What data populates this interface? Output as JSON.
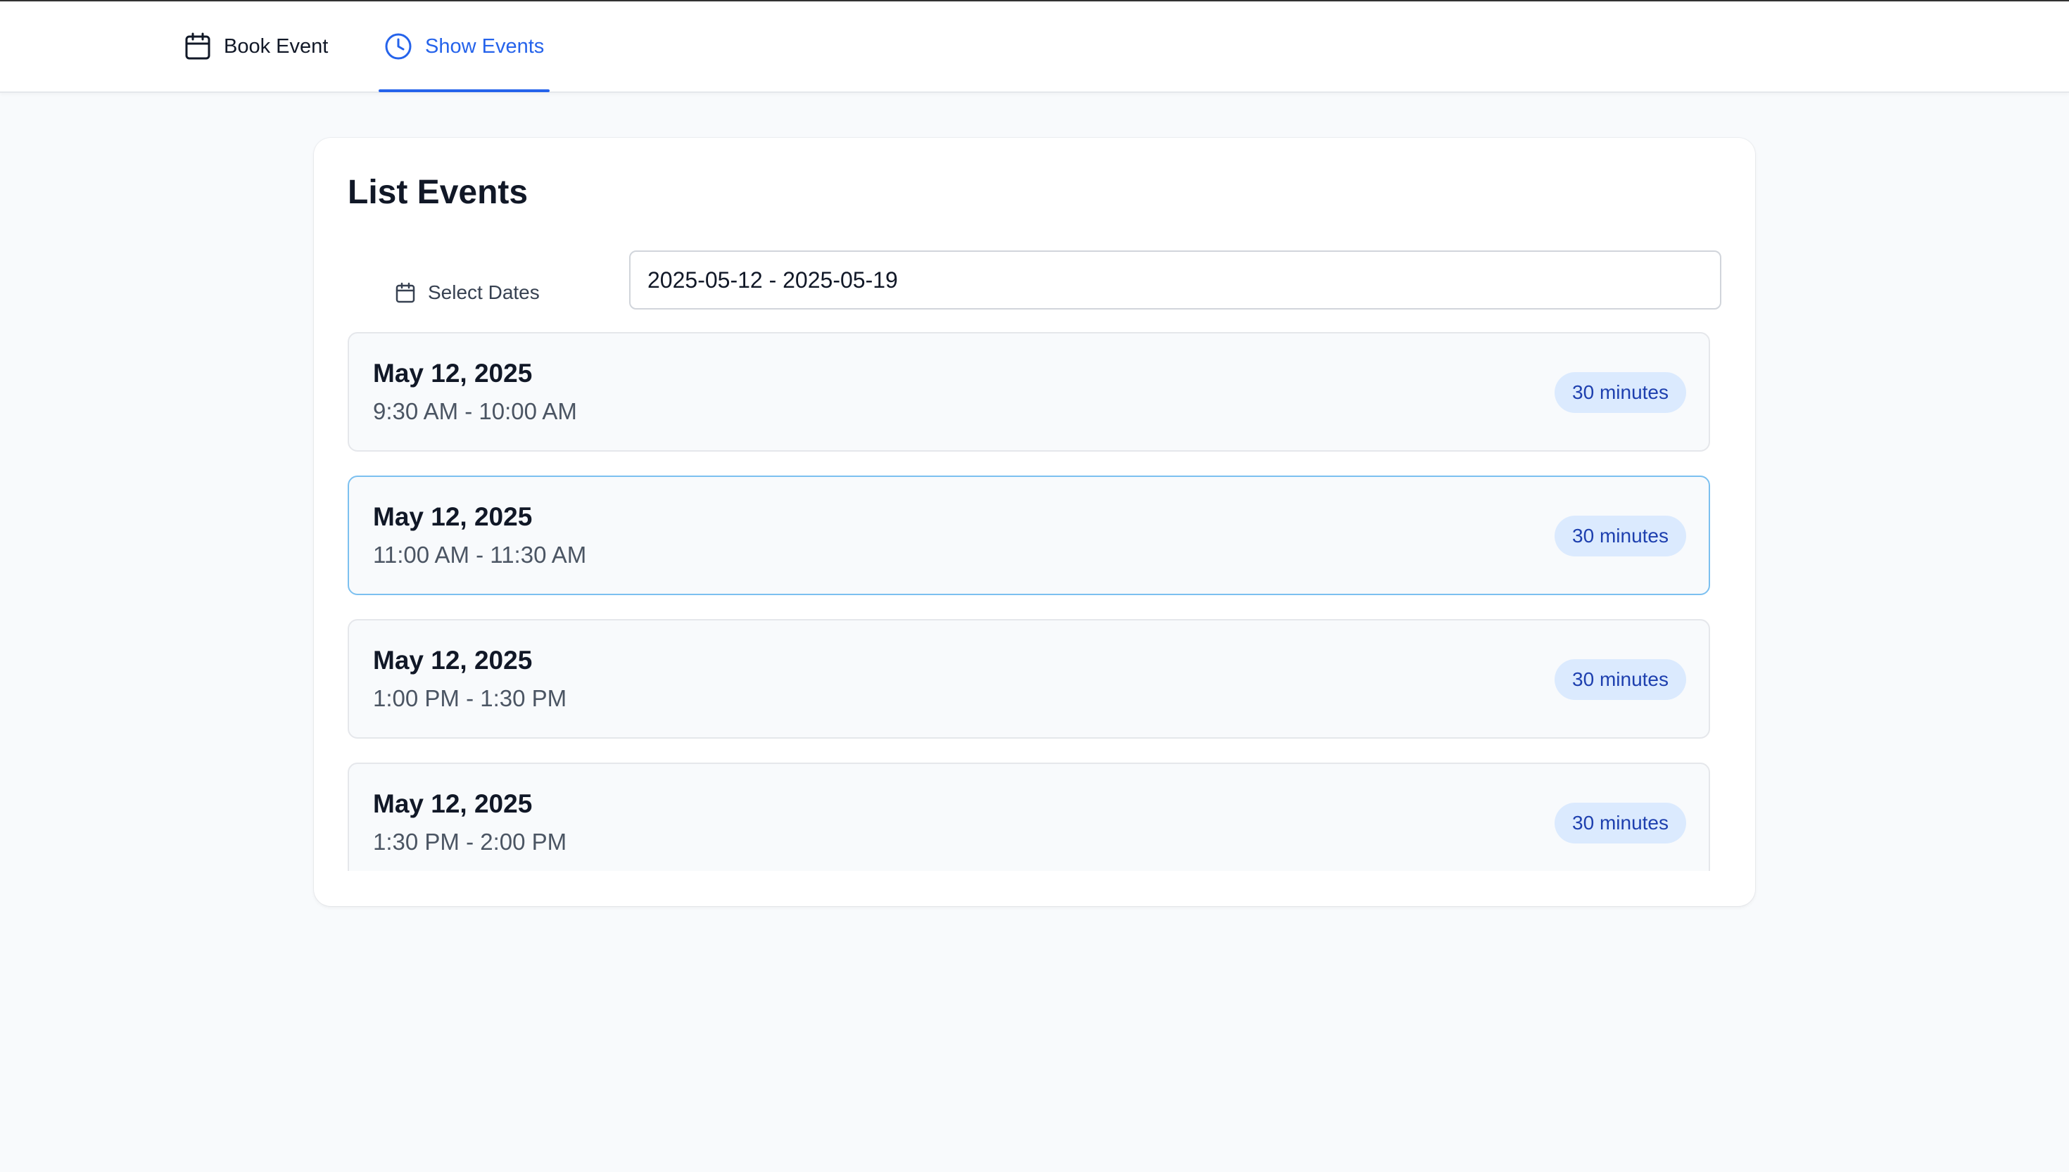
{
  "nav": {
    "tabs": [
      {
        "label": "Book Event",
        "icon": "calendar-icon",
        "active": false
      },
      {
        "label": "Show Events",
        "icon": "clock-icon",
        "active": true
      }
    ]
  },
  "main": {
    "title": "List Events",
    "date_picker": {
      "label": "Select Dates",
      "icon": "calendar-icon",
      "value": "2025-05-12 - 2025-05-19"
    },
    "events": [
      {
        "date": "May 12, 2025",
        "time": "9:30 AM - 10:00 AM",
        "duration": "30 minutes",
        "selected": false
      },
      {
        "date": "May 12, 2025",
        "time": "11:00 AM - 11:30 AM",
        "duration": "30 minutes",
        "selected": true
      },
      {
        "date": "May 12, 2025",
        "time": "1:00 PM - 1:30 PM",
        "duration": "30 minutes",
        "selected": false
      },
      {
        "date": "May 12, 2025",
        "time": "1:30 PM - 2:00 PM",
        "duration": "30 minutes",
        "selected": false
      }
    ]
  },
  "colors": {
    "accent": "#2563eb",
    "badge_bg": "#dbeafe",
    "badge_text": "#1e40af",
    "selected_border": "#7cc0f0",
    "page_bg": "#f8fafc"
  }
}
